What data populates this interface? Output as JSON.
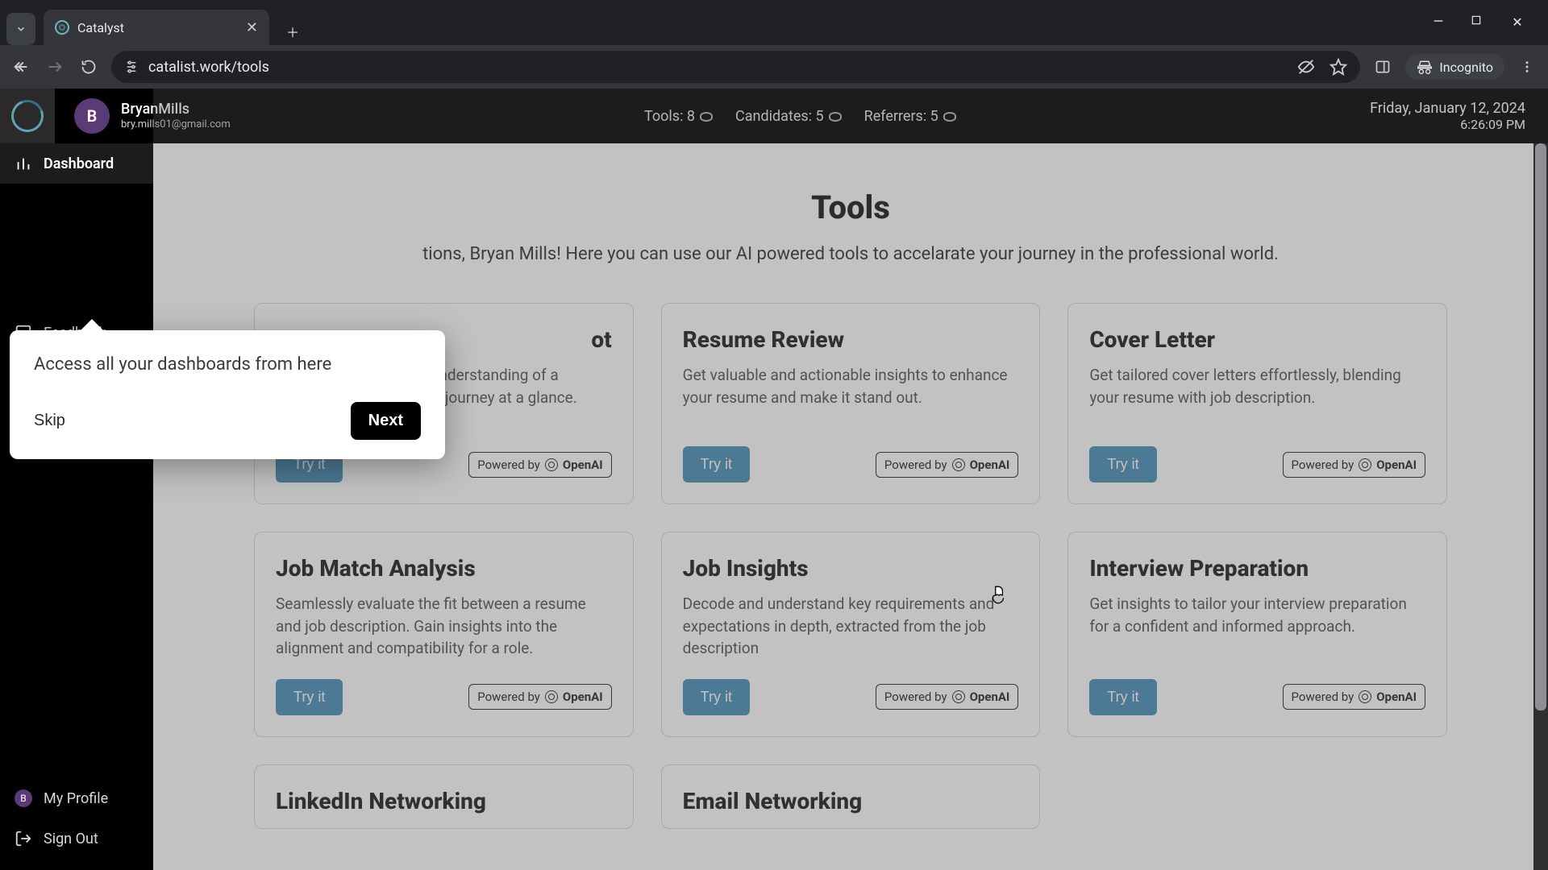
{
  "browser": {
    "tab_title": "Catalyst",
    "url": "catalist.work/tools",
    "incognito_label": "Incognito"
  },
  "app": {
    "user": {
      "initial": "B",
      "name": "BryanMills",
      "email": "bry.mills01@gmail.com"
    },
    "stats": {
      "tools": "Tools: 8",
      "candidates": "Candidates: 5",
      "referrers": "Referrers: 5"
    },
    "date": "Friday, January 12, 2024",
    "time": "6:26:09 PM"
  },
  "sidebar": {
    "items": [
      {
        "label": "Dashboard"
      },
      {
        "label": "Feedback"
      }
    ],
    "bottom": {
      "profile_initial": "B",
      "profile_label": "My Profile",
      "signout_label": "Sign Out"
    }
  },
  "tour": {
    "message": "Access all your dashboards from here",
    "skip": "Skip",
    "next": "Next"
  },
  "content": {
    "title": "Tools",
    "subtitle_suffix": "tions, Bryan Mills! Here you can use our AI powered tools to accelarate your journey in the professional world.",
    "try_label": "Try it",
    "powered_label": "Powered by",
    "powered_brand": "OpenAI",
    "cards": [
      {
        "title_suffix": "ot",
        "desc": "Gain a comprehensive understanding of a candidate's professional journey at a glance."
      },
      {
        "title": "Resume Review",
        "desc": "Get valuable and actionable insights to enhance your resume and make it stand out."
      },
      {
        "title": "Cover Letter",
        "desc": "Get tailored cover letters effortlessly, blending your resume with job description."
      },
      {
        "title": "Job Match Analysis",
        "desc": "Seamlessly evaluate the fit between a resume and job description. Gain insights into the alignment and compatibility for a role."
      },
      {
        "title": "Job Insights",
        "desc": "Decode and understand key requirements and expectations in depth, extracted from the job description"
      },
      {
        "title": "Interview Preparation",
        "desc": "Get insights to tailor your interview preparation for a confident and informed approach."
      }
    ],
    "stubs": [
      {
        "title": "LinkedIn Networking"
      },
      {
        "title": "Email Networking"
      }
    ]
  }
}
